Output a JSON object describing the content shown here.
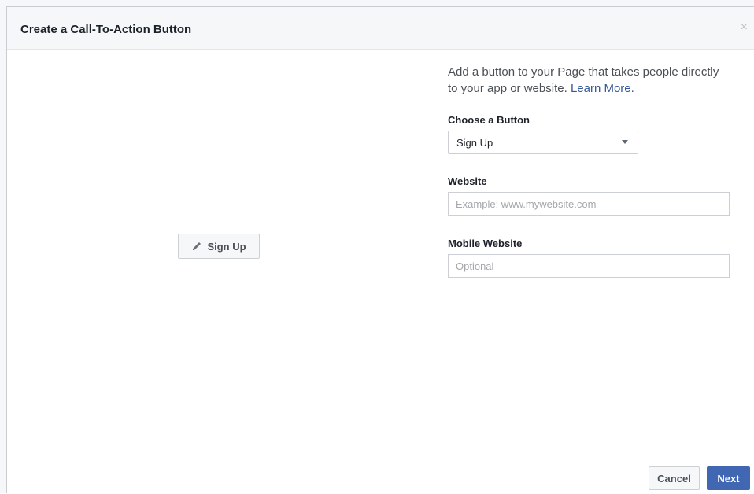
{
  "dialog": {
    "title": "Create a Call-To-Action Button",
    "close_symbol": "×"
  },
  "preview": {
    "button_label": "Sign Up",
    "icon": "pencil-icon"
  },
  "form": {
    "intro_text": "Add a button to your Page that takes people directly to your app or website.",
    "learn_more": "Learn More.",
    "choose_button_label": "Choose a Button",
    "choose_button_value": "Sign Up",
    "website_label": "Website",
    "website_placeholder": "Example: www.mywebsite.com",
    "website_value": "",
    "mobile_label": "Mobile Website",
    "mobile_placeholder": "Optional",
    "mobile_value": ""
  },
  "footer": {
    "cancel_label": "Cancel",
    "next_label": "Next"
  },
  "colors": {
    "accent": "#4267b2",
    "link": "#365899",
    "header_bg": "#f6f7f9"
  }
}
